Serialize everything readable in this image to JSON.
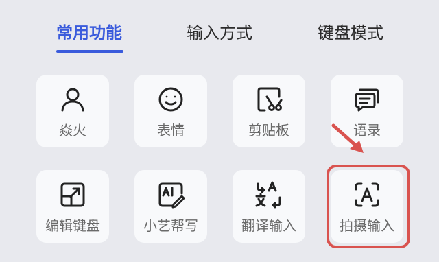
{
  "tabs": [
    {
      "label": "常用功能",
      "active": true
    },
    {
      "label": "输入方式",
      "active": false
    },
    {
      "label": "键盘模式",
      "active": false
    }
  ],
  "grid": {
    "items": [
      {
        "label": "焱火",
        "icon": "person-icon"
      },
      {
        "label": "表情",
        "icon": "smiley-icon"
      },
      {
        "label": "剪贴板",
        "icon": "scissors-clipboard-icon"
      },
      {
        "label": "语录",
        "icon": "chat-bubbles-icon"
      },
      {
        "label": "编辑键盘",
        "icon": "edit-keyboard-icon"
      },
      {
        "label": "小艺帮写",
        "icon": "ai-write-icon"
      },
      {
        "label": "翻译输入",
        "icon": "translate-icon"
      },
      {
        "label": "拍摄输入",
        "icon": "camera-text-icon"
      }
    ]
  },
  "colors": {
    "accent": "#3a5bdc",
    "annotation": "#d9534f",
    "background": "#e8e9ee",
    "tile": "#f8f9fb"
  }
}
